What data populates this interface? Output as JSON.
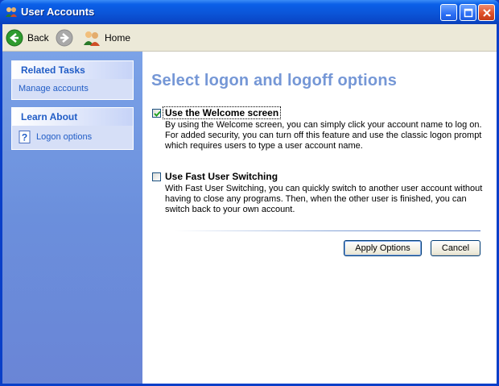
{
  "window": {
    "title": "User Accounts"
  },
  "toolbar": {
    "back_label": "Back",
    "home_label": "Home"
  },
  "sidebar": {
    "related_tasks": {
      "header": "Related Tasks",
      "items": [
        {
          "label": "Manage accounts"
        }
      ]
    },
    "learn_about": {
      "header": "Learn About",
      "items": [
        {
          "label": "Logon options",
          "icon": "help-icon"
        }
      ]
    }
  },
  "main": {
    "heading": "Select logon and logoff options",
    "options": [
      {
        "label": "Use the Welcome screen",
        "checked": true,
        "description": "By using the Welcome screen, you can simply click your account name to log on. For added security, you can turn off this feature and use the classic logon prompt which requires users to type a user account name."
      },
      {
        "label": "Use Fast User Switching",
        "checked": false,
        "description": "With Fast User Switching, you can quickly switch to another user account without having to close any programs. Then, when the other user is finished, you can switch back to your own account."
      }
    ],
    "buttons": {
      "apply": "Apply Options",
      "cancel": "Cancel"
    }
  },
  "colors": {
    "accent": "#215dc6",
    "heading": "#7597d6",
    "sidebar": "#6b8fdc",
    "titlebar": "#0a55d8"
  }
}
